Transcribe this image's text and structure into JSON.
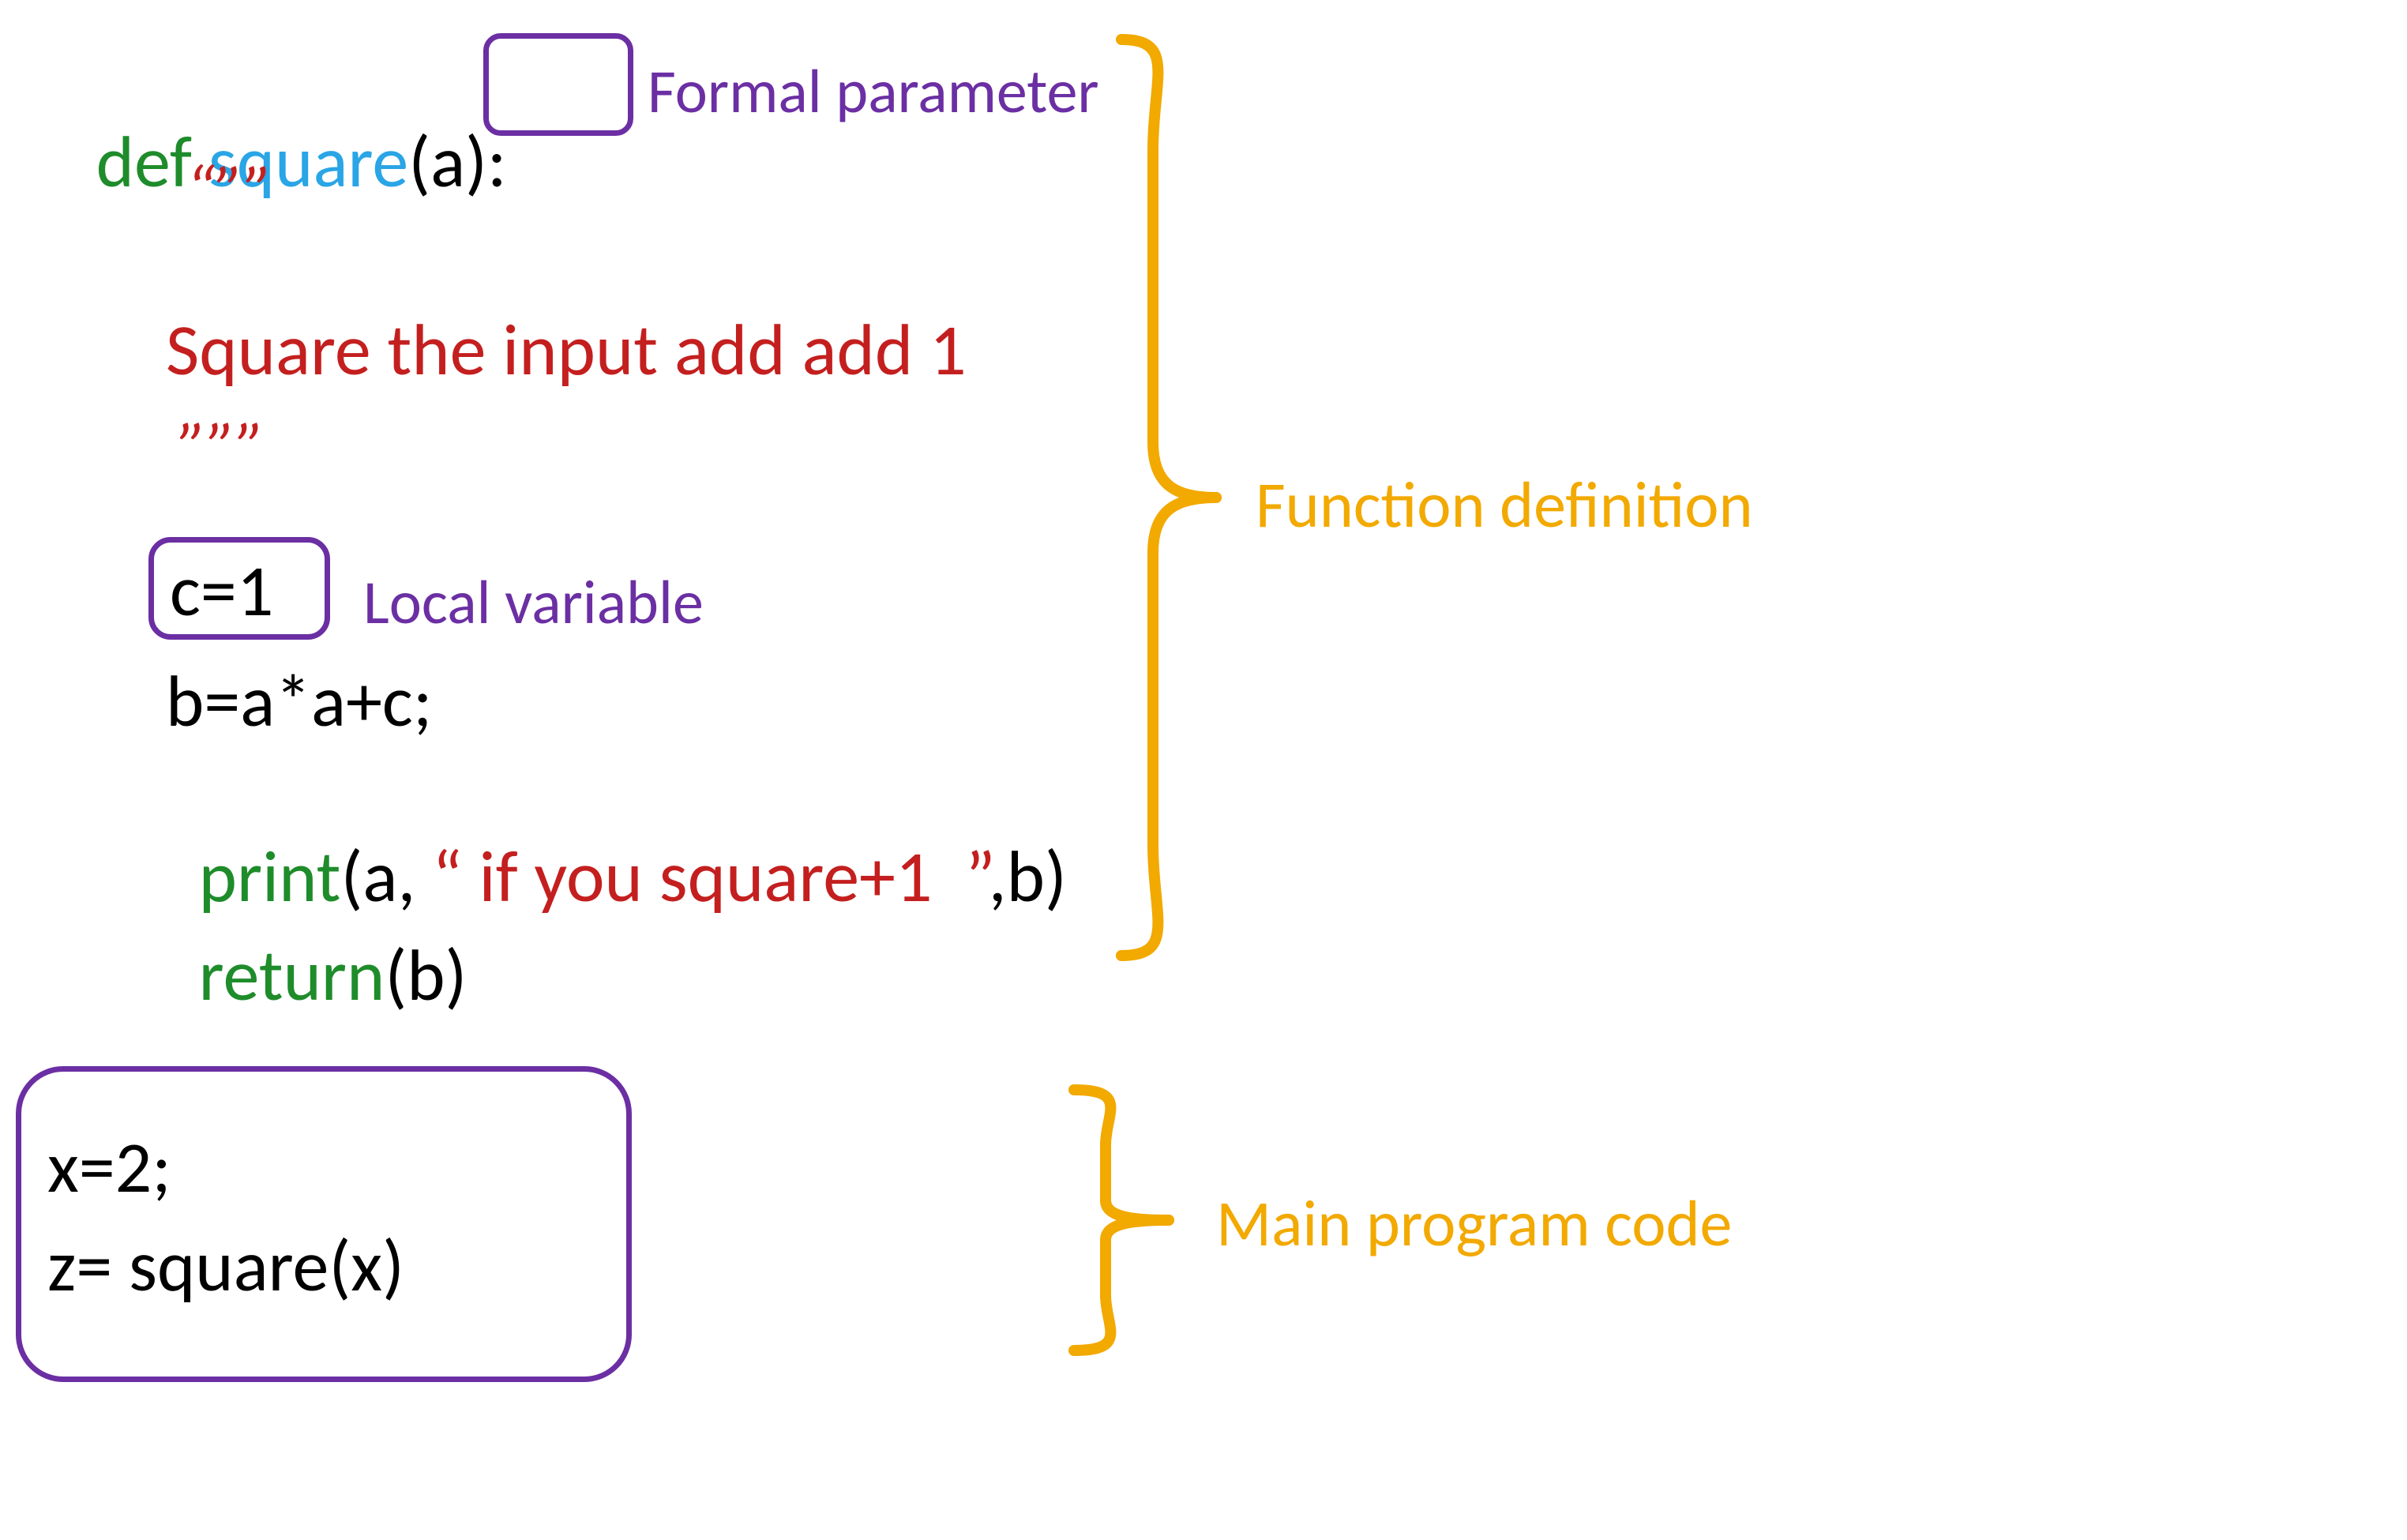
{
  "code": {
    "def_kw": "def ",
    "func_name": "square",
    "param_open": "(",
    "param": "a",
    "param_close": ")",
    "colon": ":",
    "doc_open": "“””",
    "doc_body": "Square the input add add 1",
    "doc_close": "”””",
    "local_line": "c=1",
    "body_line": "b=a*a+c;",
    "print_kw": "print",
    "print_open": "(a, ",
    "print_str": "“ if you square+1  ”",
    "print_close": ",b)",
    "return_kw": "return",
    "return_args": "(b)",
    "main1": "x=2;",
    "main2": "z= square(x)"
  },
  "labels": {
    "formal_param": "Formal parameter",
    "local_var": "Local variable",
    "func_def": "Function definition",
    "main_code": "Main program code"
  },
  "colors": {
    "keyword": "#1e8c2a",
    "identifier": "#2aa5e6",
    "string": "#c41f1f",
    "annotation": "#6b2fa3",
    "brace": "#f2a900",
    "text": "#000000"
  }
}
